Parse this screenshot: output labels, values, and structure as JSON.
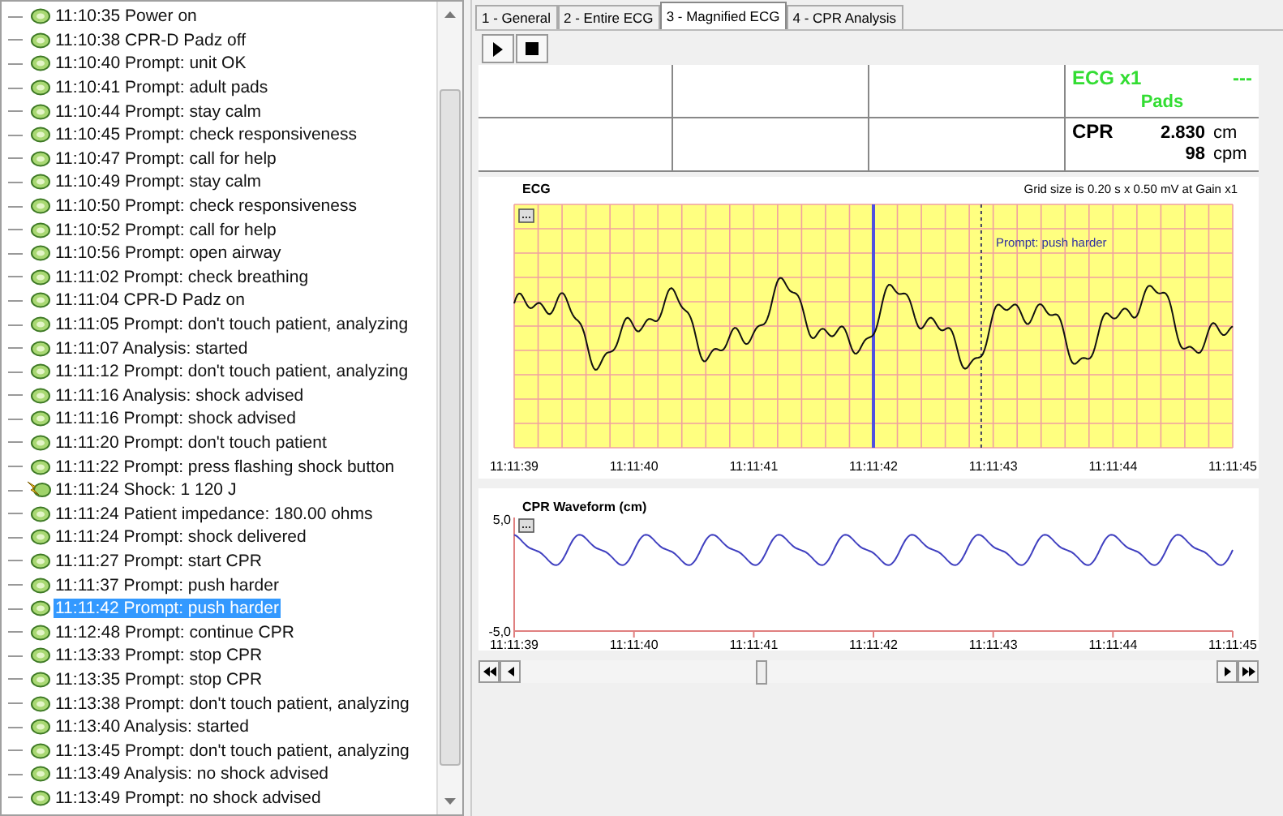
{
  "events": [
    {
      "text": "11:10:35 Power on",
      "kind": "event",
      "selected": false
    },
    {
      "text": "11:10:38 CPR-D Padz off",
      "kind": "event",
      "selected": false
    },
    {
      "text": "11:10:40 Prompt: unit OK",
      "kind": "event",
      "selected": false
    },
    {
      "text": "11:10:41 Prompt: adult pads",
      "kind": "event",
      "selected": false
    },
    {
      "text": "11:10:44 Prompt: stay calm",
      "kind": "event",
      "selected": false
    },
    {
      "text": "11:10:45 Prompt: check responsiveness",
      "kind": "event",
      "selected": false
    },
    {
      "text": "11:10:47 Prompt: call for help",
      "kind": "event",
      "selected": false
    },
    {
      "text": "11:10:49 Prompt: stay calm",
      "kind": "event",
      "selected": false
    },
    {
      "text": "11:10:50 Prompt: check responsiveness",
      "kind": "event",
      "selected": false
    },
    {
      "text": "11:10:52 Prompt: call for help",
      "kind": "event",
      "selected": false
    },
    {
      "text": "11:10:56 Prompt: open airway",
      "kind": "event",
      "selected": false
    },
    {
      "text": "11:11:02 Prompt: check breathing",
      "kind": "event",
      "selected": false
    },
    {
      "text": "11:11:04 CPR-D Padz on",
      "kind": "event",
      "selected": false
    },
    {
      "text": "11:11:05 Prompt: don't touch patient, analyzing",
      "kind": "event",
      "selected": false
    },
    {
      "text": "11:11:07 Analysis: started",
      "kind": "event",
      "selected": false
    },
    {
      "text": "11:11:12 Prompt: don't touch patient, analyzing",
      "kind": "event",
      "selected": false
    },
    {
      "text": "11:11:16 Analysis: shock advised",
      "kind": "event",
      "selected": false
    },
    {
      "text": "11:11:16 Prompt: shock advised",
      "kind": "event",
      "selected": false
    },
    {
      "text": "11:11:20 Prompt: don't touch patient",
      "kind": "event",
      "selected": false
    },
    {
      "text": "11:11:22 Prompt: press flashing shock button",
      "kind": "event",
      "selected": false
    },
    {
      "text": "11:11:24 Shock: 1 120 J",
      "kind": "shock",
      "selected": false
    },
    {
      "text": "11:11:24 Patient impedance: 180.00 ohms",
      "kind": "event",
      "selected": false
    },
    {
      "text": "11:11:24 Prompt: shock delivered",
      "kind": "event",
      "selected": false
    },
    {
      "text": "11:11:27 Prompt: start CPR",
      "kind": "event",
      "selected": false
    },
    {
      "text": "11:11:37 Prompt: push harder",
      "kind": "event",
      "selected": false
    },
    {
      "text": "11:11:42 Prompt: push harder",
      "kind": "event",
      "selected": true
    },
    {
      "text": "11:12:48 Prompt: continue CPR",
      "kind": "event",
      "selected": false
    },
    {
      "text": "11:13:33 Prompt: stop CPR",
      "kind": "event",
      "selected": false
    },
    {
      "text": "11:13:35 Prompt: stop CPR",
      "kind": "event",
      "selected": false
    },
    {
      "text": "11:13:38 Prompt: don't touch patient, analyzing",
      "kind": "event",
      "selected": false
    },
    {
      "text": "11:13:40 Analysis: started",
      "kind": "event",
      "selected": false
    },
    {
      "text": "11:13:45 Prompt: don't touch patient, analyzing",
      "kind": "event",
      "selected": false
    },
    {
      "text": "11:13:49 Analysis: no shock advised",
      "kind": "event",
      "selected": false
    },
    {
      "text": "11:13:49 Prompt: no shock advised",
      "kind": "event",
      "selected": false
    }
  ],
  "tabs": [
    {
      "label": "1 - General",
      "selected": false
    },
    {
      "label": "2 - Entire ECG",
      "selected": false
    },
    {
      "label": "3 - Magnified ECG",
      "selected": true
    },
    {
      "label": "4 - CPR Analysis",
      "selected": false
    }
  ],
  "status_panel": {
    "ecg_label": "ECG x1",
    "ecg_value": "---",
    "lead": "Pads",
    "cpr_label": "CPR",
    "depth": "2.830",
    "depth_unit": "cm",
    "rate": "98",
    "rate_unit": "cpm"
  },
  "ecg_chart": {
    "title": "ECG",
    "grid_note": "Grid size is 0.20 s x 0.50 mV at Gain x1",
    "marker_label": "Prompt: push harder",
    "time_labels": [
      "11:11:39",
      "11:11:40",
      "11:11:41",
      "11:11:42",
      "11:11:43",
      "11:11:44",
      "11:11:45"
    ]
  },
  "cpr_chart": {
    "title": "CPR Waveform (cm)",
    "y_labels": [
      "5,0",
      "-5,0"
    ],
    "time_labels": [
      "11:11:39",
      "11:11:40",
      "11:11:41",
      "11:11:42",
      "11:11:43",
      "11:11:44",
      "11:11:45"
    ]
  }
}
